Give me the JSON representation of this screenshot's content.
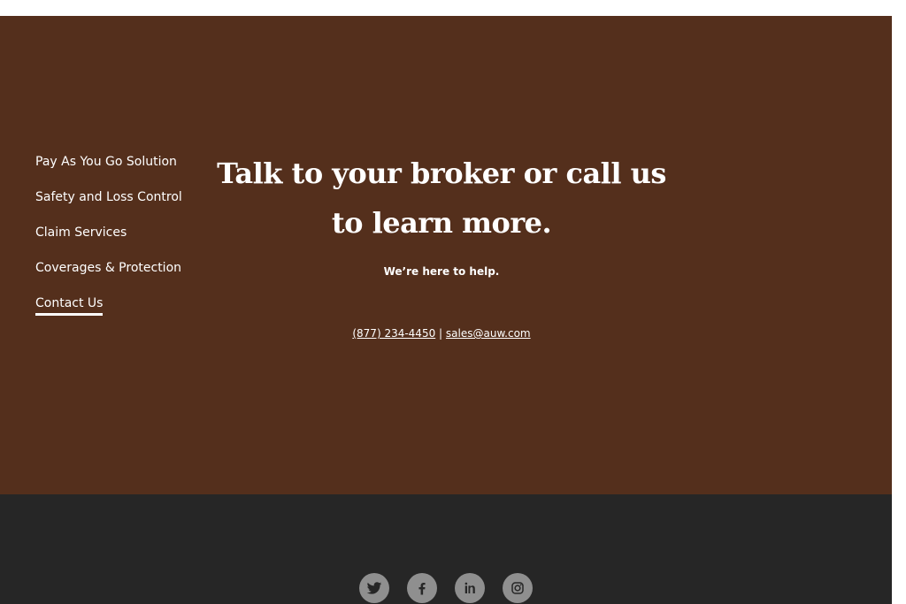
{
  "nav": {
    "items": [
      {
        "label": "Pay As You Go Solution"
      },
      {
        "label": "Safety and Loss Control"
      },
      {
        "label": "Claim Services"
      },
      {
        "label": "Coverages & Protection"
      },
      {
        "label": "Contact Us",
        "active": true
      }
    ]
  },
  "cta": {
    "heading_line1": "Talk to your broker or call us",
    "heading_line2": "to learn more.",
    "subheading": "We’re here to help.",
    "phone": "(877) 234-4450",
    "separator": "|",
    "email": "sales@auw.com"
  },
  "footer": {
    "social": [
      {
        "icon": "twitter-icon"
      },
      {
        "icon": "facebook-icon"
      },
      {
        "icon": "linkedin-icon"
      },
      {
        "icon": "instagram-icon"
      }
    ]
  },
  "colors": {
    "section_bg": "#542f1c",
    "footer_bg": "#262626",
    "social_icon_bg": "#8f8f8f",
    "text": "#ffffff"
  }
}
